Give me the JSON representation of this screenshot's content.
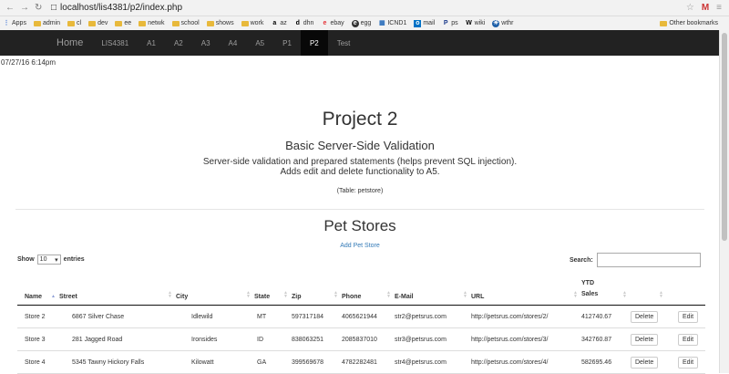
{
  "browser": {
    "url": "localhost/lis4381/p2/index.php",
    "bookmarks": [
      {
        "label": "Apps",
        "icon": "apps-icon"
      },
      {
        "label": "admin",
        "icon": "folder-icon"
      },
      {
        "label": "cl",
        "icon": "folder-icon"
      },
      {
        "label": "dev",
        "icon": "folder-icon"
      },
      {
        "label": "ee",
        "icon": "folder-icon"
      },
      {
        "label": "netwk",
        "icon": "folder-icon"
      },
      {
        "label": "school",
        "icon": "folder-icon"
      },
      {
        "label": "shows",
        "icon": "folder-icon"
      },
      {
        "label": "work",
        "icon": "folder-icon"
      },
      {
        "label": "az",
        "icon": "amazon-icon"
      },
      {
        "label": "dhn",
        "icon": "d-icon"
      },
      {
        "label": "ebay",
        "icon": "ebay-icon"
      },
      {
        "label": "egg",
        "icon": "egg-icon"
      },
      {
        "label": "ICND1",
        "icon": "icnd-icon"
      },
      {
        "label": "mail",
        "icon": "outlook-icon"
      },
      {
        "label": "ps",
        "icon": "ps-icon"
      },
      {
        "label": "wiki",
        "icon": "wikipedia-icon"
      },
      {
        "label": "wthr",
        "icon": "weather-icon"
      }
    ],
    "other_bookmarks": "Other bookmarks"
  },
  "navbar": {
    "brand": "Home",
    "items": [
      "LIS4381",
      "A1",
      "A2",
      "A3",
      "A4",
      "A5",
      "P1",
      "P2",
      "Test"
    ],
    "active": "P2"
  },
  "timestamp": "07/27/16 6:14pm",
  "header": {
    "title": "Project 2",
    "subtitle": "Basic Server-Side Validation",
    "desc1": "Server-side validation and prepared statements (helps prevent SQL injection).",
    "desc2": "Adds edit and delete functionality to A5.",
    "table_note": "(Table: petstore)"
  },
  "section": {
    "title": "Pet Stores",
    "add_link": "Add Pet Store"
  },
  "datatable": {
    "show_label": "Show",
    "entries_value": "10",
    "entries_label": "entries",
    "search_label": "Search:",
    "columns": [
      "Name",
      "Street",
      "City",
      "State",
      "Zip",
      "Phone",
      "E-Mail",
      "URL",
      "YTD Sales"
    ],
    "rows": [
      {
        "name": "Store 2",
        "street": "6867 Silver Chase",
        "city": "Idlewild",
        "state": "MT",
        "zip": "597317184",
        "phone": "4065621944",
        "email": "str2@petsrus.com",
        "url": "http://petsrus.com/stores/2/",
        "sales": "412740.67"
      },
      {
        "name": "Store 3",
        "street": "281 Jagged Road",
        "city": "Ironsides",
        "state": "ID",
        "zip": "838063251",
        "phone": "2085837010",
        "email": "str3@petsrus.com",
        "url": "http://petsrus.com/stores/3/",
        "sales": "342760.87"
      },
      {
        "name": "Store 4",
        "street": "5345 Tawny Hickory Falls",
        "city": "Kilowatt",
        "state": "GA",
        "zip": "399569678",
        "phone": "4782282481",
        "email": "str4@petsrus.com",
        "url": "http://petsrus.com/stores/4/",
        "sales": "582695.46"
      }
    ],
    "delete_label": "Delete",
    "edit_label": "Edit"
  }
}
